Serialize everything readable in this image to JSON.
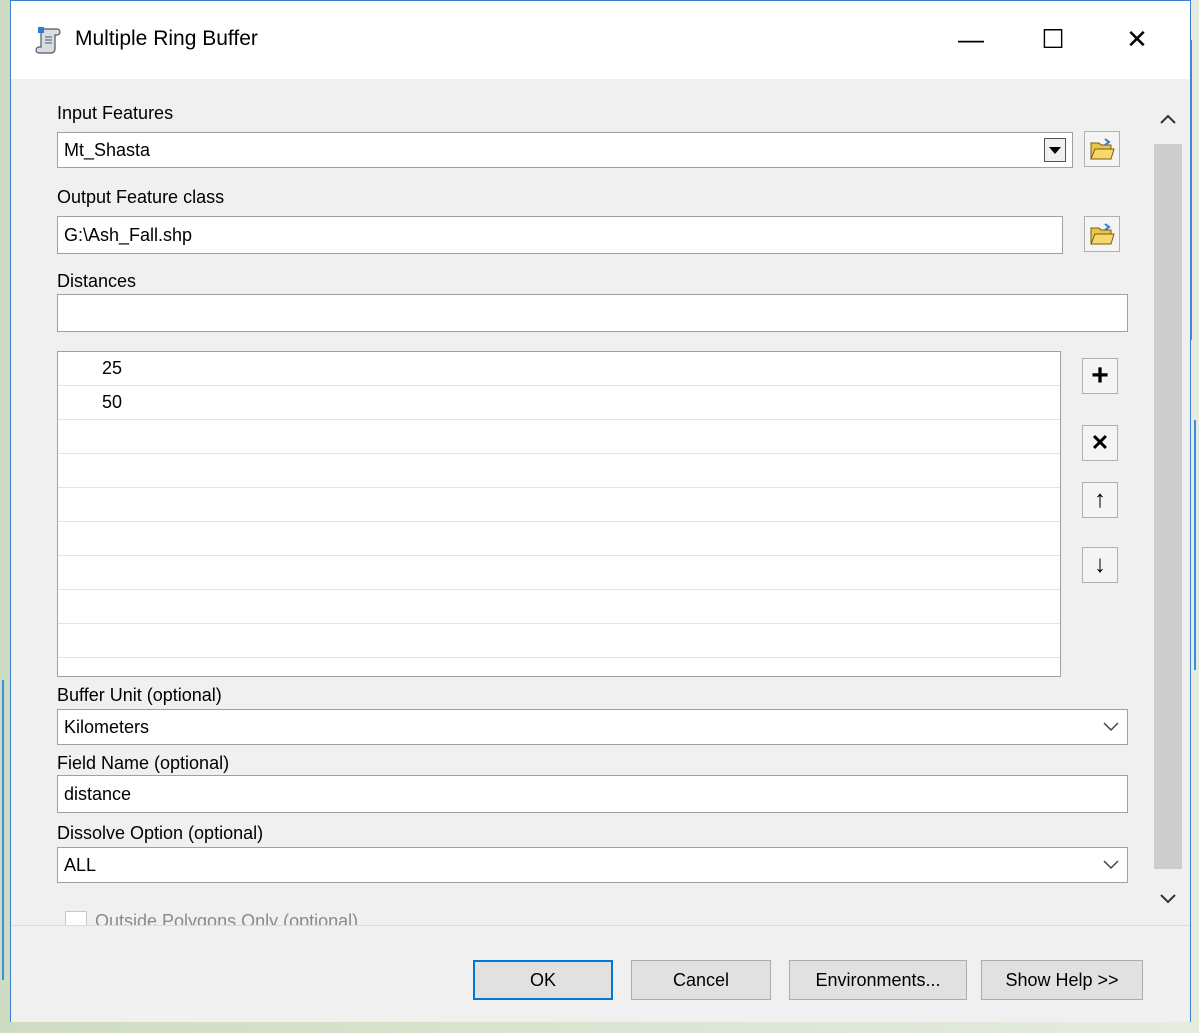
{
  "window": {
    "title": "Multiple Ring Buffer",
    "minimize_glyph": "—",
    "maximize_glyph": "☐",
    "close_glyph": "✕"
  },
  "input_features": {
    "label": "Input Features",
    "value": "Mt_Shasta"
  },
  "output_feature_class": {
    "label": "Output Feature class",
    "value": "G:\\Ash_Fall.shp"
  },
  "distances": {
    "label": "Distances",
    "input_value": "",
    "rows": [
      "25",
      "50",
      "",
      "",
      "",
      "",
      "",
      "",
      ""
    ]
  },
  "list_buttons": {
    "add": "+",
    "remove": "✕",
    "up": "↑",
    "down": "↓"
  },
  "buffer_unit": {
    "label": "Buffer Unit (optional)",
    "value": "Kilometers"
  },
  "field_name": {
    "label": "Field Name (optional)",
    "value": "distance"
  },
  "dissolve_option": {
    "label": "Dissolve Option (optional)",
    "value": "ALL"
  },
  "outside_polygons": {
    "label": "Outside Polygons Only (optional)",
    "checked": false
  },
  "buttons": {
    "ok": "OK",
    "cancel": "Cancel",
    "environments": "Environments...",
    "show_help": "Show Help >>"
  },
  "colors": {
    "accent": "#0078d7",
    "river": "#3a8fe0",
    "folder": "#e8c64a"
  }
}
